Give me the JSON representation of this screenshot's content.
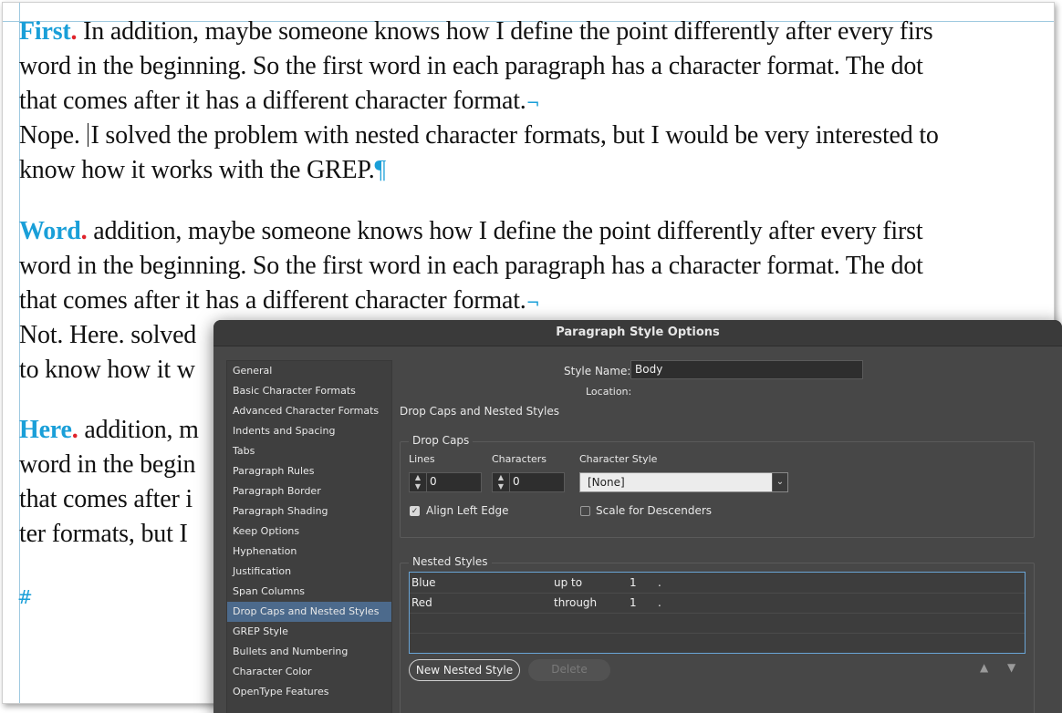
{
  "document": {
    "paragraph1": {
      "lead": "First",
      "dot": ".",
      "line1": " In addition, maybe someone knows how I define the point differently after every firs",
      "line2": "word in the beginning. So the first word in each paragraph has a character format. The dot",
      "line3": "that comes after it has a different character format.",
      "line4a": "Nope.",
      "line4b": "I solved the problem with nested character formats, but I would be very interested to",
      "line5": "know how it works with the GREP."
    },
    "paragraph2": {
      "lead": "Word",
      "dot": ".",
      "line1": " addition, maybe someone knows how I define the point differently after every first",
      "line2": "word in the beginning. So the first word in each paragraph has a character format. The dot",
      "line3": "that comes after it has a different character format.",
      "line4": "Not. Here.  solved",
      "line5": "to know how it w"
    },
    "paragraph3": {
      "lead": "Here",
      "dot": ".",
      "line1": " addition, m",
      "line2": "word in the begin",
      "line3": "that comes after i",
      "line4": "ter formats, but I"
    },
    "end_marker": "#",
    "colors": {
      "blue": "#1a9fd8",
      "red": "#e0232b"
    }
  },
  "dialog": {
    "title": "Paragraph Style Options",
    "sidebar_items": [
      "General",
      "Basic Character Formats",
      "Advanced Character Formats",
      "Indents and Spacing",
      "Tabs",
      "Paragraph Rules",
      "Paragraph Border",
      "Paragraph Shading",
      "Keep Options",
      "Hyphenation",
      "Justification",
      "Span Columns",
      "Drop Caps and Nested Styles",
      "GREP Style",
      "Bullets and Numbering",
      "Character Color",
      "OpenType Features"
    ],
    "selected_item": "Drop Caps and Nested Styles",
    "style_name_label": "Style Name:",
    "style_name_value": "Body",
    "location_label": "Location:",
    "section_title": "Drop Caps and Nested Styles",
    "drop_caps": {
      "group_label": "Drop Caps",
      "lines_label": "Lines",
      "lines_value": "0",
      "characters_label": "Characters",
      "characters_value": "0",
      "char_style_label": "Character Style",
      "char_style_value": "[None]",
      "align_left_edge_label": "Align Left Edge",
      "align_left_edge_checked": true,
      "scale_for_descenders_label": "Scale for Descenders",
      "scale_for_descenders_checked": false
    },
    "nested_styles": {
      "group_label": "Nested Styles",
      "rows": [
        {
          "style": "Blue",
          "mode": "up to",
          "count": "1",
          "char": "."
        },
        {
          "style": "Red",
          "mode": "through",
          "count": "1",
          "char": "."
        }
      ],
      "new_button": "New Nested Style",
      "delete_button": "Delete"
    },
    "accent_color": "#4c6a8c"
  }
}
